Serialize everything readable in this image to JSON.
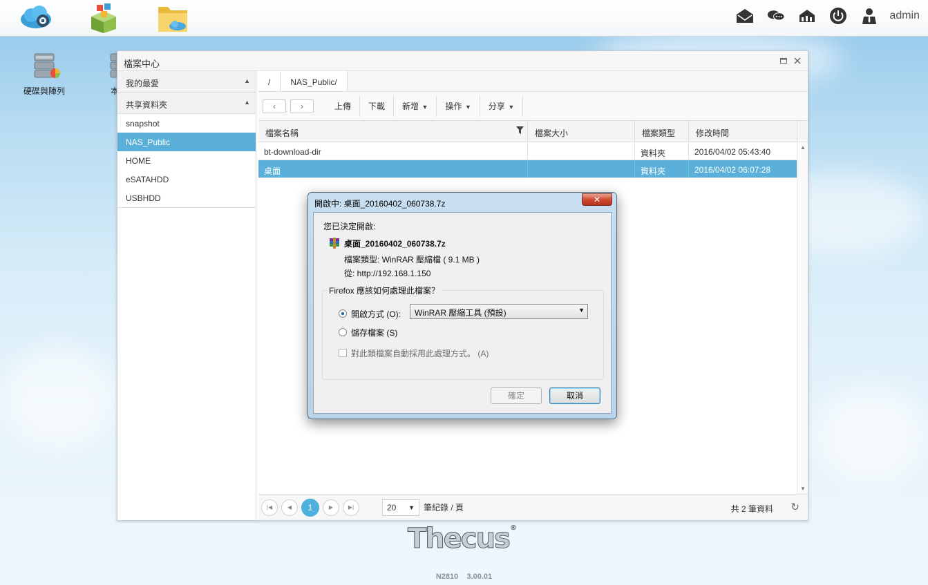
{
  "topbar": {
    "user": "admin",
    "icons": [
      "cloud-icon",
      "app-store-icon",
      "folder-icon"
    ],
    "right_icons": [
      "mail-icon",
      "chat-icon",
      "network-icon",
      "power-icon",
      "user-icon"
    ]
  },
  "desktop": {
    "icons": [
      {
        "label": "硬碟與陣列",
        "icon": "disk-array-icon"
      },
      {
        "label": "本",
        "icon": "disk-icon"
      }
    ]
  },
  "window": {
    "title": "檔案中心",
    "sidebar": {
      "favorites_label": "我的最愛",
      "shared_label": "共享資料夾",
      "items": [
        {
          "label": "snapshot"
        },
        {
          "label": "NAS_Public",
          "active": true
        },
        {
          "label": "HOME"
        },
        {
          "label": "eSATAHDD"
        },
        {
          "label": "USBHDD"
        }
      ]
    },
    "breadcrumb": [
      "/",
      "NAS_Public/"
    ],
    "toolbar": {
      "upload": "上傳",
      "download": "下載",
      "new": "新增",
      "operate": "操作",
      "share": "分享"
    },
    "table": {
      "columns": [
        "檔案名稱",
        "檔案大小",
        "檔案類型",
        "修改時間"
      ],
      "rows": [
        {
          "name": "bt-download-dir",
          "size": "",
          "type": "資料夾",
          "modified": "2016/04/02 05:43:40",
          "selected": false
        },
        {
          "name": "桌面",
          "size": "",
          "type": "資料夾",
          "modified": "2016/04/02 06:07:28",
          "selected": true
        }
      ]
    },
    "pager": {
      "current_page": "1",
      "page_size": "20",
      "page_size_label": "筆紀錄 / 頁",
      "total": "共 2 筆資料"
    }
  },
  "dialog": {
    "title": "開啟中: 桌面_20160402_060738.7z",
    "decided": "您已決定開啟:",
    "filename": "桌面_20160402_060738.7z",
    "file_type": "檔案類型:  WinRAR 壓縮檔 ( 9.1 MB )",
    "from": "從:  http://192.168.1.150",
    "question": "Firefox 應該如何處理此檔案？",
    "open_with": "開啟方式 (O):",
    "open_with_app": "WinRAR 壓縮工具 (預設)",
    "save_file": "儲存檔案 (S)",
    "auto_apply": "對此類檔案自動採用此處理方式。 (A)",
    "ok": "確定",
    "cancel": "取消",
    "open_selected": true
  },
  "footer": {
    "logo": "Thecus",
    "reg": "®",
    "version": "N2810    3.00.01"
  }
}
